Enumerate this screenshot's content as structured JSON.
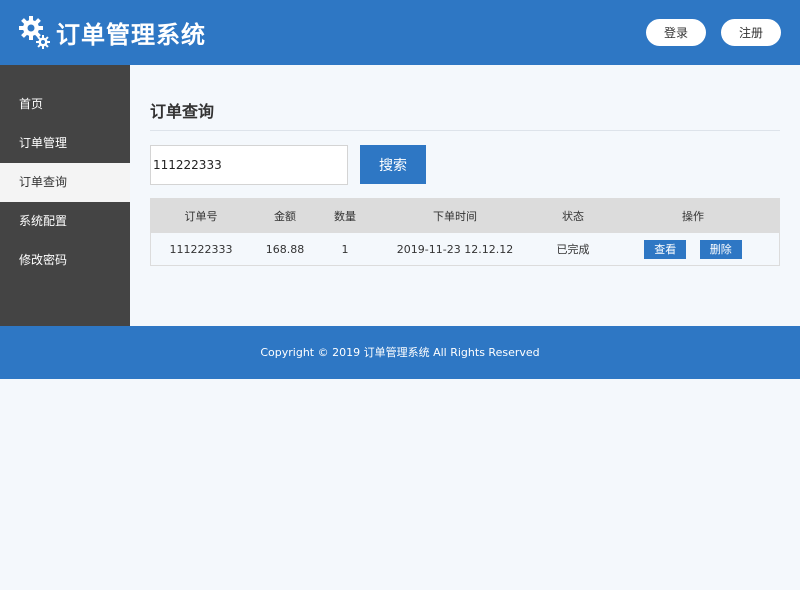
{
  "header": {
    "title": "订单管理系统",
    "login_label": "登录",
    "register_label": "注册"
  },
  "sidebar": {
    "items": [
      {
        "label": "首页"
      },
      {
        "label": "订单管理"
      },
      {
        "label": "订单查询",
        "active": true
      },
      {
        "label": "系统配置"
      },
      {
        "label": "修改密码"
      }
    ]
  },
  "main": {
    "title": "订单查询",
    "search": {
      "value": "111222333",
      "button_label": "搜索"
    },
    "table": {
      "columns": [
        "订单号",
        "金额",
        "数量",
        "下单时间",
        "状态",
        "操作"
      ],
      "rows": [
        {
          "order_no": "111222333",
          "amount": "168.88",
          "quantity": "1",
          "time": "2019-11-23 12.12.12",
          "status": "已完成",
          "view_label": "查看",
          "delete_label": "删除"
        }
      ]
    }
  },
  "footer": {
    "text": "Copyright © 2019 订单管理系统 All Rights Reserved"
  },
  "colors": {
    "primary": "#2e77c4",
    "sidebar": "#444444",
    "background": "#f4f8fc"
  }
}
